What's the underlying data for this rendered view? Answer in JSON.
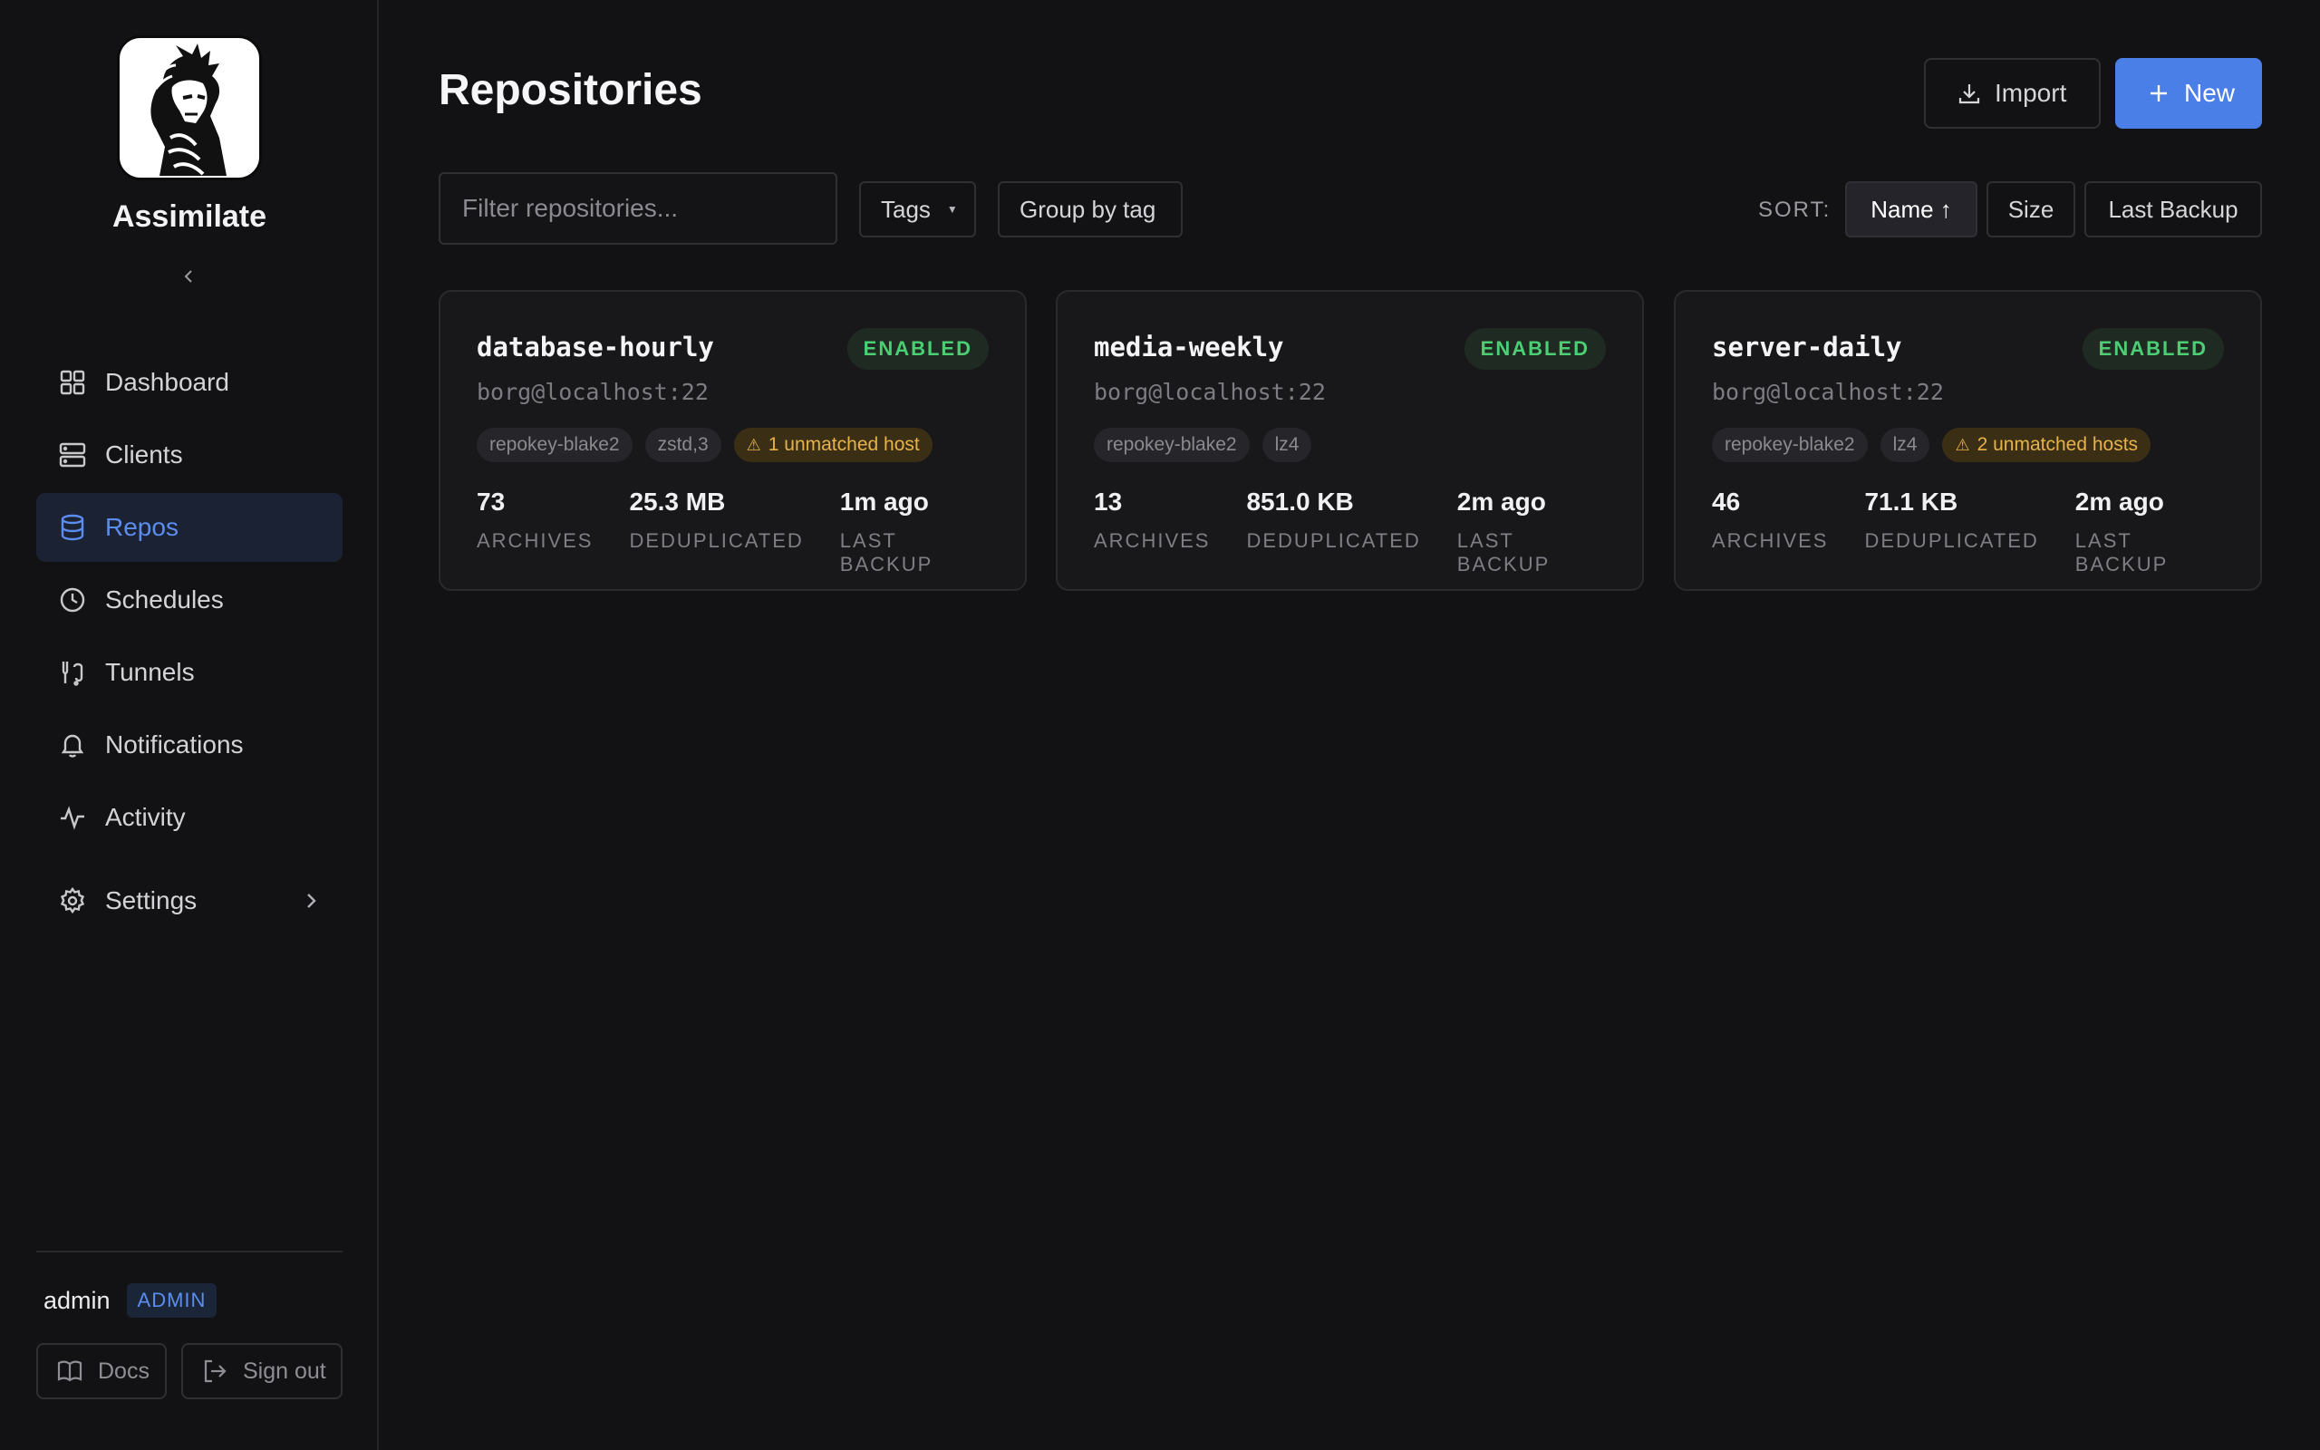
{
  "app": {
    "name": "Assimilate"
  },
  "nav": [
    {
      "label": "Dashboard",
      "icon": "dashboard-icon"
    },
    {
      "label": "Clients",
      "icon": "server-icon"
    },
    {
      "label": "Repos",
      "icon": "database-icon",
      "active": true
    },
    {
      "label": "Schedules",
      "icon": "clock-icon"
    },
    {
      "label": "Tunnels",
      "icon": "tunnel-icon"
    },
    {
      "label": "Notifications",
      "icon": "bell-icon"
    },
    {
      "label": "Activity",
      "icon": "activity-icon"
    },
    {
      "label": "Settings",
      "icon": "gear-icon"
    }
  ],
  "user": {
    "name": "admin",
    "role": "ADMIN"
  },
  "footer": {
    "docs_label": "Docs",
    "signout_label": "Sign out"
  },
  "page": {
    "title": "Repositories",
    "import_label": "Import",
    "new_label": "New",
    "filter_placeholder": "Filter repositories...",
    "tags_label": "Tags",
    "group_label": "Group by tag",
    "sort_label": "SORT:",
    "sort_options": [
      "Name ↑",
      "Size",
      "Last Backup"
    ]
  },
  "repos": [
    {
      "name": "database-hourly",
      "status": "ENABLED",
      "host": "borg@localhost:22",
      "chips": [
        "repokey-blake2",
        "zstd,3"
      ],
      "warning": "1 unmatched host",
      "archives": "73",
      "dedup": "25.3 MB",
      "last_backup": "1m ago"
    },
    {
      "name": "media-weekly",
      "status": "ENABLED",
      "host": "borg@localhost:22",
      "chips": [
        "repokey-blake2",
        "lz4"
      ],
      "warning": "",
      "archives": "13",
      "dedup": "851.0 KB",
      "last_backup": "2m ago"
    },
    {
      "name": "server-daily",
      "status": "ENABLED",
      "host": "borg@localhost:22",
      "chips": [
        "repokey-blake2",
        "lz4"
      ],
      "warning": "2 unmatched hosts",
      "archives": "46",
      "dedup": "71.1 KB",
      "last_backup": "2m ago"
    }
  ],
  "stat_labels": {
    "archives": "ARCHIVES",
    "dedup": "DEDUPLICATED",
    "last_backup": "LAST BACKUP"
  },
  "colors": {
    "accent": "#4a7fe8",
    "active_nav": "#5b8def",
    "enabled": "#4ccf74",
    "warning": "#e8b24a",
    "background": "#121214"
  }
}
